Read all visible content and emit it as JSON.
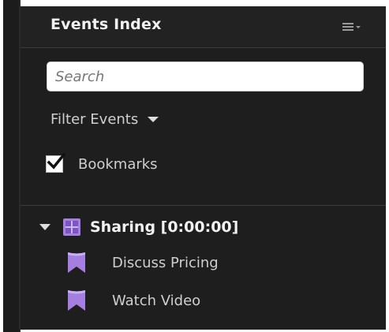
{
  "panel": {
    "title": "Events Index",
    "menu_icon": "panel-menu-icon"
  },
  "search": {
    "placeholder": "Search",
    "value": ""
  },
  "filter": {
    "label": "Filter Events",
    "icon": "chevron-down-icon"
  },
  "bookmarks": {
    "label": "Bookmarks",
    "checked": true
  },
  "tree": {
    "group": {
      "label": "Sharing [0:00:00]",
      "icon": "layout-icon",
      "expanded": true
    },
    "events": [
      {
        "label": "Discuss Pricing",
        "icon": "bookmark-flag-icon"
      },
      {
        "label": "Watch Video",
        "icon": "bookmark-flag-icon"
      }
    ]
  },
  "colors": {
    "background": "#1e1e1e",
    "accent_purple": "#a47fe0",
    "text": "#cfcfcf"
  }
}
